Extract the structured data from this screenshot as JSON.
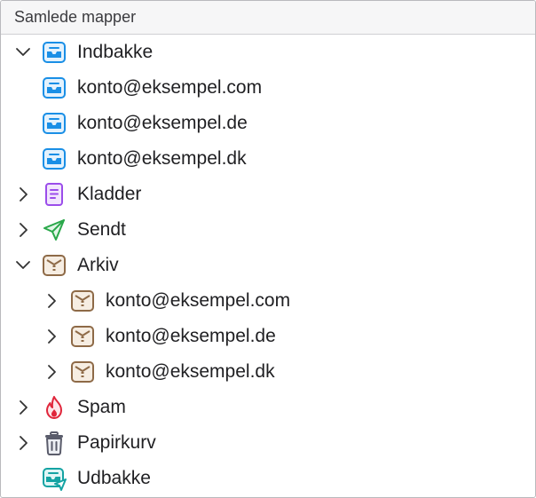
{
  "header": {
    "title": "Samlede mapper"
  },
  "folders": [
    {
      "label": "Indbakke",
      "icon": "inbox-icon",
      "state": "expanded"
    },
    {
      "label": "konto@eksempel.com",
      "icon": "inbox-icon"
    },
    {
      "label": "konto@eksempel.de",
      "icon": "inbox-icon"
    },
    {
      "label": "konto@eksempel.dk",
      "icon": "inbox-icon"
    },
    {
      "label": "Kladder",
      "icon": "drafts-icon",
      "state": "collapsed"
    },
    {
      "label": "Sendt",
      "icon": "sent-icon",
      "state": "collapsed"
    },
    {
      "label": "Arkiv",
      "icon": "archive-icon",
      "state": "expanded"
    },
    {
      "label": "konto@eksempel.com",
      "icon": "archive-icon",
      "state": "collapsed"
    },
    {
      "label": "konto@eksempel.de",
      "icon": "archive-icon",
      "state": "collapsed"
    },
    {
      "label": "konto@eksempel.dk",
      "icon": "archive-icon",
      "state": "collapsed"
    },
    {
      "label": "Spam",
      "icon": "spam-icon",
      "state": "collapsed"
    },
    {
      "label": "Papirkurv",
      "icon": "trash-icon",
      "state": "collapsed"
    },
    {
      "label": "Udbakke",
      "icon": "outbox-icon"
    }
  ],
  "colors": {
    "inbox": "#1a8fe6",
    "drafts": "#9b4dea",
    "sent": "#2aa84a",
    "archive": "#8e6a47",
    "spam": "#e0263b",
    "trash": "#5a5c6b",
    "outbox": "#14a3a3"
  }
}
